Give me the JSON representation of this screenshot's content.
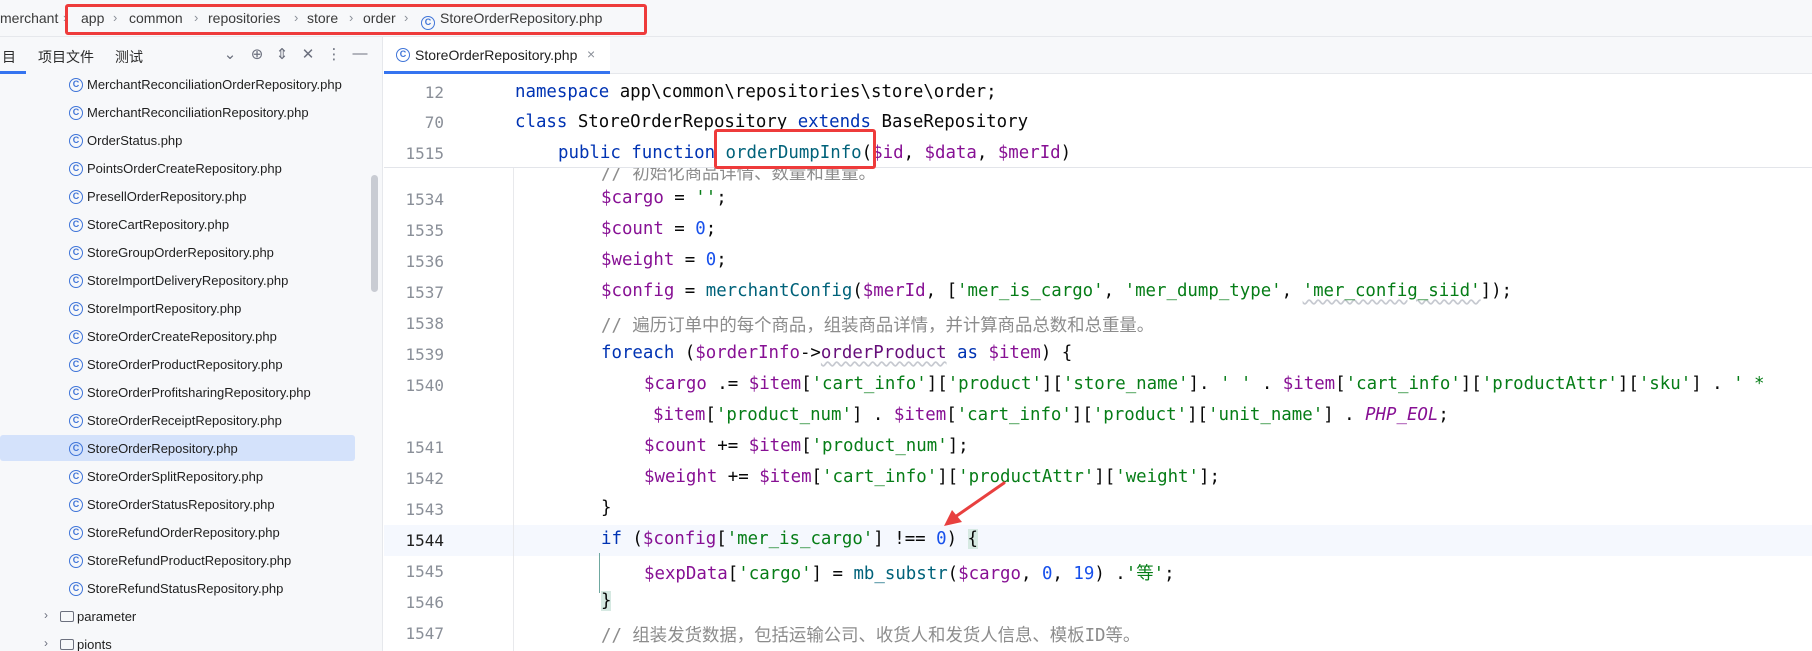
{
  "breadcrumb": {
    "items": [
      "merchant",
      "app",
      "common",
      "repositories",
      "store",
      "order"
    ],
    "file": "StoreOrderRepository.php"
  },
  "sidebar": {
    "tabs": [
      "目",
      "项目文件",
      "测试"
    ],
    "files": [
      "MerchantReconciliationOrderRepository.php",
      "MerchantReconciliationRepository.php",
      "OrderStatus.php",
      "PointsOrderCreateRepository.php",
      "PresellOrderRepository.php",
      "StoreCartRepository.php",
      "StoreGroupOrderRepository.php",
      "StoreImportDeliveryRepository.php",
      "StoreImportRepository.php",
      "StoreOrderCreateRepository.php",
      "StoreOrderProductRepository.php",
      "StoreOrderProfitsharingRepository.php",
      "StoreOrderReceiptRepository.php",
      "StoreOrderRepository.php",
      "StoreOrderSplitRepository.php",
      "StoreOrderStatusRepository.php",
      "StoreRefundOrderRepository.php",
      "StoreRefundProductRepository.php",
      "StoreRefundStatusRepository.php"
    ],
    "selected_file": "StoreOrderRepository.php",
    "folders": [
      "parameter",
      "pionts"
    ]
  },
  "editor": {
    "tab_label": "StoreOrderRepository.php",
    "sticky_lines": [
      "12",
      "70",
      "1515"
    ],
    "line_numbers": [
      "1534",
      "1535",
      "1536",
      "1537",
      "1538",
      "1539",
      "1540",
      "",
      "1541",
      "1542",
      "1543",
      "1544",
      "1545",
      "1546",
      "1547"
    ],
    "current_line": "1544",
    "sticky_code": {
      "namespace_kw": "namespace",
      "namespace_val": " app\\common\\repositories\\store\\order;",
      "class_kw": "class",
      "class_name": " StoreOrderRepository ",
      "extends_kw": "extends",
      "base": " BaseRepository",
      "public_kw": "public",
      "function_kw": " function ",
      "method_name": "orderDumpInfo",
      "params_open": "(",
      "p1": "$id",
      "comma1": ", ",
      "p2": "$data",
      "comma2": ", ",
      "p3": "$merId",
      "params_close": ")"
    },
    "partial_comment": "// 初始化商品详情、数量和重量。",
    "comments": {
      "c1538": "// 遍历订单中的每个商品，组装商品详情，并计算商品总数和总重量。",
      "c1547": "// 组装发货数据，包括运输公司、收货人和发货人信息、模板ID等。"
    },
    "tokens": {
      "cargo": "$cargo",
      "count": "$count",
      "weight": "$weight",
      "config": "$config",
      "item": "$item",
      "orderInfo": "$orderInfo",
      "merId": "$merId",
      "expData": "$expData",
      "empty_str": "''",
      "zero": "0",
      "nineteen": "19",
      "merchantConfig": "merchantConfig",
      "mb_substr": "mb_substr",
      "foreach": "foreach",
      "as": "as",
      "if": "if",
      "orderProduct": "orderProduct",
      "PHP_EOL": "PHP_EOL",
      "s_mer_is_cargo": "'mer_is_cargo'",
      "s_mer_dump_type": "'mer_dump_type'",
      "s_mer_config_siid": "'mer_config_siid'",
      "s_cart_info": "'cart_info'",
      "s_product": "'product'",
      "s_store_name": "'store_name'",
      "s_space": "' '",
      "s_productAttr": "'productAttr'",
      "s_sku": "'sku'",
      "s_star": "' *",
      "s_product_num": "'product_num'",
      "s_unit_name": "'unit_name'",
      "s_weight": "'weight'",
      "s_cargo": "'cargo'",
      "s_deng": "'等'"
    }
  },
  "colors": {
    "highlight_box": "#ee3b3b",
    "arrow": "#e8403f",
    "selection": "#d4e2fb",
    "accent": "#3574f0"
  }
}
